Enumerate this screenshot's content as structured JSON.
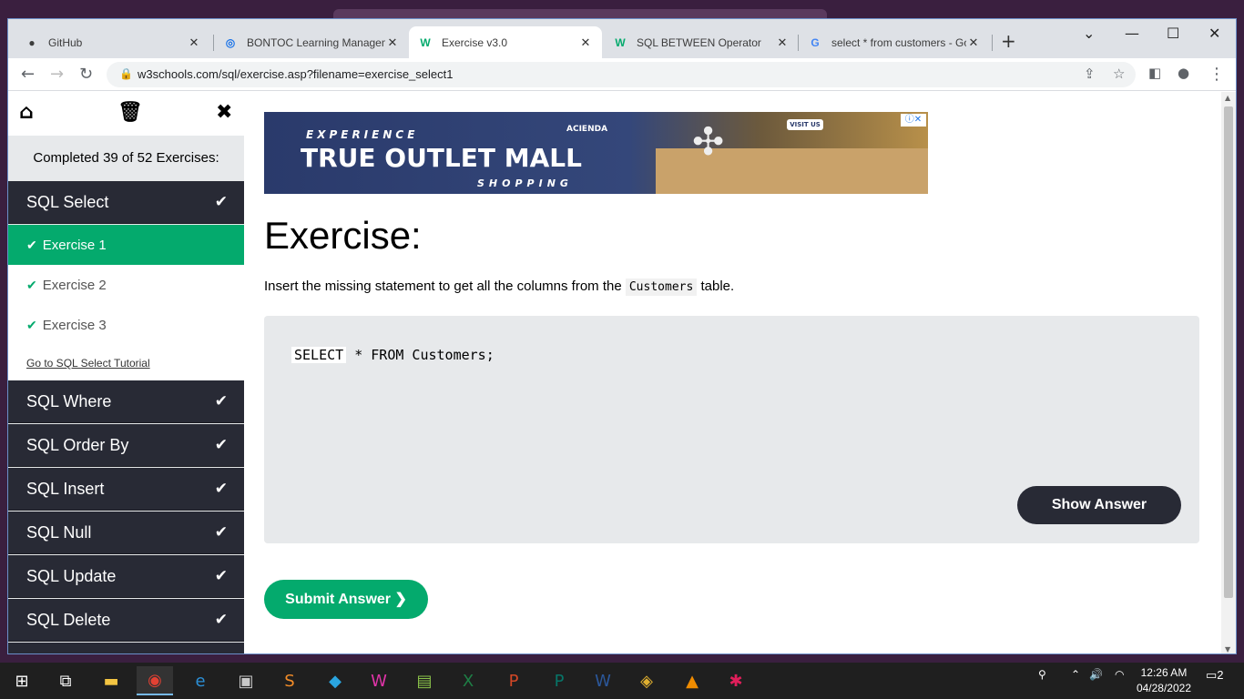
{
  "browser": {
    "tabs": [
      {
        "label": "GitHub",
        "icon": "github-icon"
      },
      {
        "label": "BONTOC Learning Managem",
        "icon": "moodle-icon"
      },
      {
        "label": "Exercise v3.0",
        "icon": "w3schools-icon",
        "active": true
      },
      {
        "label": "SQL BETWEEN Operator",
        "icon": "w3schools-icon"
      },
      {
        "label": "select * from customers - Go",
        "icon": "google-icon"
      }
    ],
    "url": "w3schools.com/sql/exercise.asp?filename=exercise_select1"
  },
  "sidebar": {
    "progress": "Completed 39 of 52 Exercises:",
    "go_to_tutorial": "Go to SQL Select Tutorial",
    "categories": [
      {
        "label": "SQL Select",
        "completed": true
      },
      {
        "label": "SQL Where",
        "completed": true
      },
      {
        "label": "SQL Order By",
        "completed": true
      },
      {
        "label": "SQL Insert",
        "completed": true
      },
      {
        "label": "SQL Null",
        "completed": true
      },
      {
        "label": "SQL Update",
        "completed": true
      },
      {
        "label": "SQL Delete",
        "completed": true
      }
    ],
    "exercises": [
      {
        "label": "Exercise 1",
        "active": true
      },
      {
        "label": "Exercise 2"
      },
      {
        "label": "Exercise 3"
      }
    ]
  },
  "ad": {
    "line1": "EXPERIENCE",
    "line2": "TRUE OUTLET MALL",
    "line3": "SHOPPING",
    "brand": "ACIENDA",
    "visit": "VISIT US"
  },
  "main": {
    "heading": "Exercise:",
    "instruction_before": "Insert the missing statement to get all the columns from the",
    "instruction_code": "Customers",
    "instruction_after": "table.",
    "code_input_value": "SELECT",
    "code_rest": "* FROM Customers;",
    "show_answer": "Show Answer",
    "submit": "Submit Answer ❯"
  },
  "taskbar": {
    "time": "12:26 AM",
    "date": "04/28/2022",
    "notifications": "2"
  },
  "colors": {
    "accent_green": "#04aa6d",
    "sidebar_dark": "#282a35",
    "exercise_bg": "#e7e9eb"
  }
}
